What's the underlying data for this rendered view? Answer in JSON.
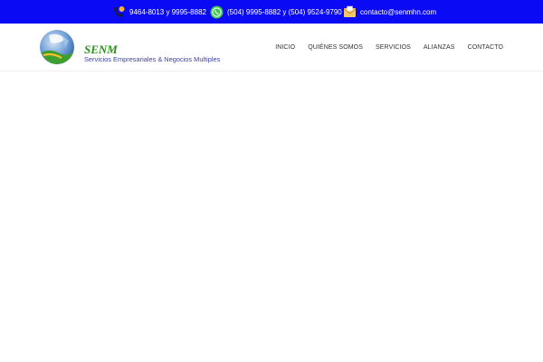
{
  "colors": {
    "topbar_bg": "#0a0af5",
    "topbar_text": "#ffffff",
    "brand_green": "#2e8f1e",
    "brand_blue": "#3b3fa8",
    "nav_text": "#333333"
  },
  "topbar": {
    "phone": {
      "icon": "phone-icon",
      "text": "9464-8013 y 9995-8882"
    },
    "whatsapp": {
      "icon": "whatsapp-icon",
      "text": "(504) 9995-8882 y (504) 9524-9790"
    },
    "email": {
      "icon": "envelope-icon",
      "text": "contacto@senmhn.com"
    }
  },
  "logo": {
    "name": "SENM",
    "tagline": "Servicios Empresariales & Negocios Multiples"
  },
  "nav": {
    "items": [
      "INICIO",
      "QUIÉNES SOMOS",
      "SERVICIOS",
      "ALIANZAS",
      "CONTACTO"
    ]
  }
}
